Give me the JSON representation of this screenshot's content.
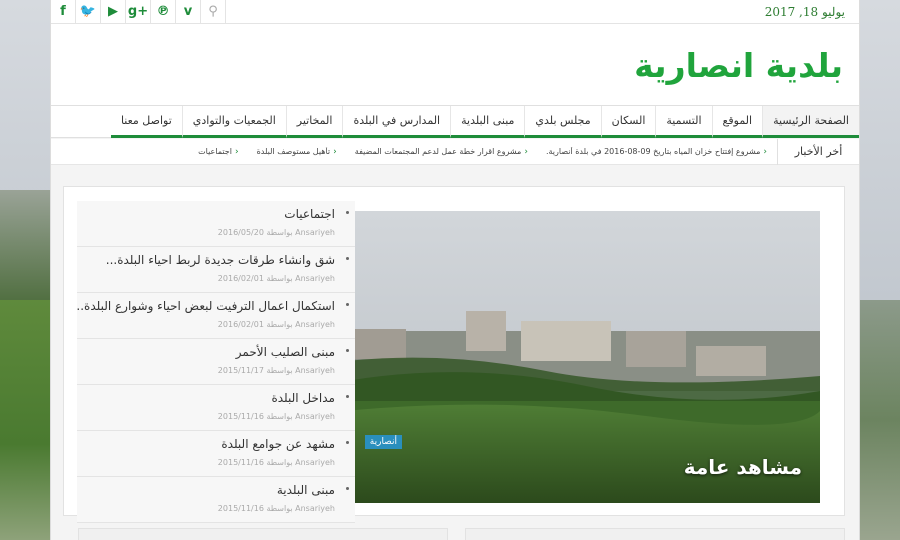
{
  "date": "يوليو 18, 2017",
  "site_title": "بلدية انصارية",
  "social": [
    "f-icon",
    "twitter-icon",
    "youtube-icon",
    "gplus-icon",
    "pinterest-icon",
    "vimeo-icon",
    "search-icon"
  ],
  "social_glyphs": [
    "f",
    "🐦",
    "▶",
    "g+",
    "℗",
    "v",
    "⚲"
  ],
  "nav": [
    "الصفحة الرئيسية",
    "الموقع",
    "التسمية",
    "السكان",
    "مجلس بلدي",
    "مبنى البلدية",
    "المدارس في البلدة",
    "المخاتير",
    "الجمعيات والتوادي",
    "تواصل معنا"
  ],
  "ticker": {
    "title": "أخر الأخبار",
    "items": [
      "مشروع إفتتاح خزان المياه بتاريخ 09-08-2016 في بلدة أنصارية.",
      "مشروع اقرار خطة عمل لدعم المجتمعات المضيفة",
      "تأهيل مستوصف البلدة",
      "اجتماعيات"
    ]
  },
  "slider": {
    "badge": "أنصارية",
    "title": "مشاهد عامة"
  },
  "posts": [
    {
      "title": "اجتماعيات",
      "meta": "Ansariyeh بواسطة 2016/05/20"
    },
    {
      "title": "شق وانشاء طرقات جديدة لربط احياء البلدة...",
      "meta": "Ansariyeh بواسطة 2016/02/01"
    },
    {
      "title": "استكمال اعمال الترفيت لبعض احياء وشوارع البلدة...",
      "meta": "Ansariyeh بواسطة 2016/02/01"
    },
    {
      "title": "مبنى الصليب الأحمر",
      "meta": "Ansariyeh بواسطة 2015/11/17"
    },
    {
      "title": "مداخل البلدة",
      "meta": "Ansariyeh بواسطة 2015/11/16"
    },
    {
      "title": "مشهد عن جوامع البلدة",
      "meta": "Ansariyeh بواسطة 2015/11/16"
    },
    {
      "title": "مبنى البلدية",
      "meta": "Ansariyeh بواسطة 2015/11/16"
    }
  ],
  "colors": {
    "accent": "#1e8c3a",
    "logo": "#20a43c",
    "badge": "#2a8fbd"
  }
}
